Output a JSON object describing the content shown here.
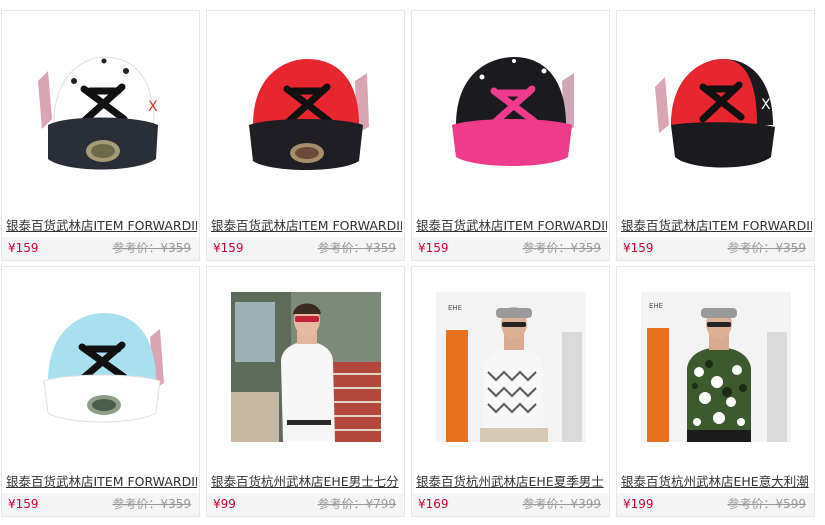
{
  "currency": "¥",
  "ref_prefix": "参考价：",
  "products": [
    {
      "title": "银泰百货武林店ITEM FORWARDIF",
      "price": "¥159",
      "ref_price": "参考价：¥359",
      "image": "white-black-snapback-cap-icon"
    },
    {
      "title": "银泰百货武林店ITEM FORWARDIF",
      "price": "¥159",
      "ref_price": "参考价：¥359",
      "image": "red-black-snapback-cap-icon"
    },
    {
      "title": "银泰百货武林店ITEM FORWARDIF",
      "price": "¥159",
      "ref_price": "参考价：¥359",
      "image": "black-pink-snapback-cap-icon"
    },
    {
      "title": "银泰百货武林店ITEM FORWARDIF",
      "price": "¥159",
      "ref_price": "参考价：¥359",
      "image": "red-black-trucker-cap-icon"
    },
    {
      "title": "银泰百货武林店ITEM FORWARDIF",
      "price": "¥159",
      "ref_price": "参考价：¥359",
      "image": "lightblue-white-snapback-cap-icon"
    },
    {
      "title": "银泰百货杭州武林店EHE男士七分",
      "price": "¥99",
      "ref_price": "参考价：¥799",
      "image": "man-white-shirt-photo"
    },
    {
      "title": "银泰百货杭州武林店EHE夏季男士",
      "price": "¥169",
      "ref_price": "参考价：¥399",
      "image": "man-zigzag-shirt-photo"
    },
    {
      "title": "银泰百货杭州武林店EHE意大利潮",
      "price": "¥199",
      "ref_price": "参考价：¥599",
      "image": "man-camo-shirt-photo"
    }
  ],
  "colors": {
    "price": "#cc0033",
    "ref_price": "#999999",
    "cap_white": "#ffffff",
    "cap_red": "#e8262f",
    "cap_black": "#1b1b1f",
    "cap_pink": "#ee3b8c",
    "cap_lightblue": "#a9e0ef"
  }
}
